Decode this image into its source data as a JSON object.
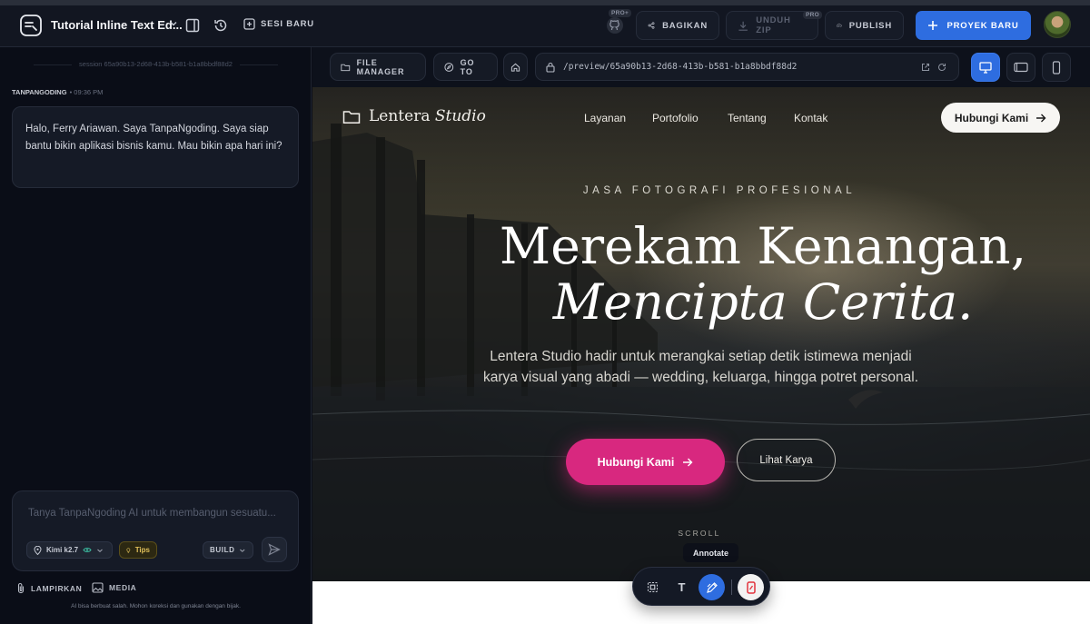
{
  "topbar": {
    "project_title": "Tutorial Inline Text Ed...",
    "sesi_baru": "SESI BARU",
    "pro_badge": "PRO+",
    "bagikan": "BAGIKAN",
    "unduh_zip": "UNDUH ZIP",
    "unduh_badge": "PRO",
    "publish": "PUBLISH",
    "proyek_baru": "PROYEK BARU"
  },
  "sidebar": {
    "session": "session 65a90b13-2d68-413b-b581-b1a8bbdf88d2",
    "message_author": "TANPANGODING",
    "message_time": "• 09:36 PM",
    "message_text": "Halo, Ferry Ariawan. Saya TanpaNgoding. Saya siap bantu bikin aplikasi bisnis kamu. Mau bikin apa hari ini?",
    "composer_placeholder": "Tanya TanpaNgoding AI untuk membangun sesuatu...",
    "model": "Kimi k2.7",
    "tips": "Tips",
    "mode": "BUILD",
    "lampirkan": "LAMPIRKAN",
    "media": "MEDIA",
    "disclaimer": "AI bisa berbuat salah. Mohon koreksi dan gunakan dengan bijak."
  },
  "urlbar": {
    "file_manager": "FILE MANAGER",
    "go_to": "GO TO",
    "url": "/preview/65a90b13-2d68-413b-b581-b1a8bbdf88d2"
  },
  "preview": {
    "brand_main": "Lentera",
    "brand_italic": "Studio",
    "nav": [
      "Layanan",
      "Portofolio",
      "Tentang",
      "Kontak"
    ],
    "hubungi_top": "Hubungi Kami",
    "eyebrow": "JASA FOTOGRAFI PROFESIONAL",
    "headline_1": "Merekam Kenangan,",
    "headline_2": "Mencipta Cerita.",
    "subtitle": "Lentera Studio hadir untuk merangkai setiap detik istimewa menjadi karya visual yang abadi — wedding, keluarga, hingga potret personal.",
    "cta_primary": "Hubungi Kami",
    "cta_secondary": "Lihat Karya",
    "scroll": "SCROLL"
  },
  "annotate_toolbar": {
    "tooltip": "Annotate",
    "text_tool": "T"
  },
  "colors": {
    "accent_blue": "#2e6de0",
    "cta_pink": "#d8287f",
    "background": "#0b0e18"
  }
}
